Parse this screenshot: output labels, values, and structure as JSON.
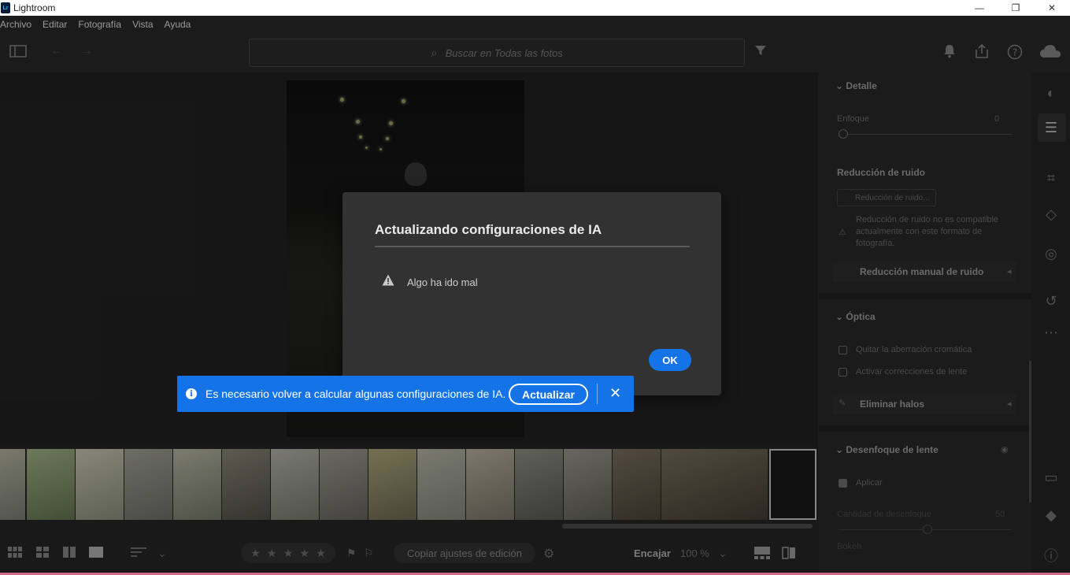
{
  "window": {
    "title": "Lightroom",
    "logo": "Lr",
    "minimize_glyph": "—",
    "maximize_glyph": "❐",
    "close_glyph": "✕"
  },
  "menu": [
    "Archivo",
    "Editar",
    "Fotografía",
    "Vista",
    "Ayuda"
  ],
  "toolbar": {
    "search_placeholder": "Buscar en Todas las fotos",
    "icons": [
      "sidebar-toggle-icon",
      "back-arrow-icon",
      "forward-arrow-icon",
      "filter-icon",
      "bell-icon",
      "share-icon",
      "help-icon",
      "cloud-icon"
    ]
  },
  "right_panel": {
    "detalle": {
      "title": "Detalle",
      "sharpen_label": "Enfoque",
      "sharpen_value": "0"
    },
    "noise": {
      "title": "Reducción de ruido",
      "button": "Reducción de ruido...",
      "warning": "Reducción de ruido no es compatible actualmente con este formato de fotografía.",
      "manual": "Reducción manual de ruido"
    },
    "optica": {
      "title": "Óptica",
      "check1": "Quitar la aberración cromática",
      "check2": "Activar correcciones de lente",
      "defringe": "Eliminar halos"
    },
    "lens_blur": {
      "title": "Desenfoque de lente",
      "apply": "Aplicar",
      "amount_label": "Cantidad de desenfoque",
      "amount_value": "50",
      "bokeh_label": "Bokeh"
    }
  },
  "bottom_bar": {
    "copy_settings": "Copiar ajustes de edición",
    "fit": "Encajar",
    "zoom": "100 %"
  },
  "dialog": {
    "title": "Actualizando configuraciones de IA",
    "message": "Algo ha ido mal",
    "ok": "OK"
  },
  "toast": {
    "message": "Es necesario volver a calcular algunas configuraciones de IA.",
    "action": "Actualizar",
    "info_glyph": "i",
    "close_glyph": "✕"
  },
  "colors": {
    "accent": "#1473e6",
    "dialog_bg": "#323232",
    "app_bg": "#1e1e1e"
  }
}
